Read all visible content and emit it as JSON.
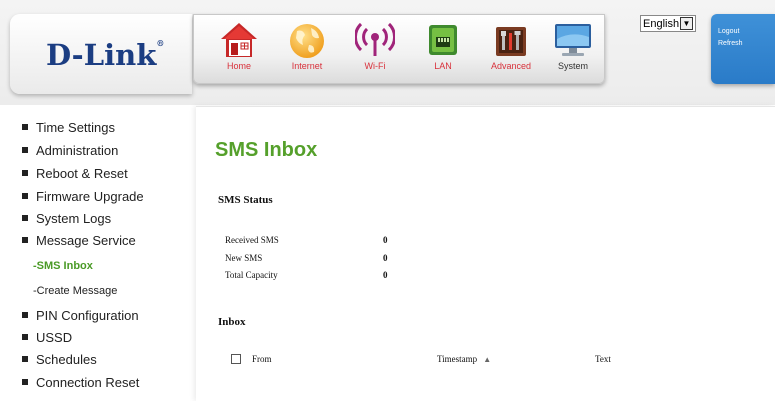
{
  "brand": {
    "logo_text": "D-Link",
    "logo_mark": "®"
  },
  "nav": {
    "items": [
      {
        "label": "Home",
        "icon": "home-icon"
      },
      {
        "label": "Internet",
        "icon": "globe-icon"
      },
      {
        "label": "Wi-Fi",
        "icon": "wifi-icon"
      },
      {
        "label": "LAN",
        "icon": "lan-icon"
      },
      {
        "label": "Advanced",
        "icon": "toolbox-icon"
      },
      {
        "label": "System",
        "icon": "monitor-icon"
      }
    ],
    "active": "System"
  },
  "language": {
    "selected": "English"
  },
  "account": {
    "logout": "Logout",
    "refresh": "Refresh"
  },
  "sidebar": {
    "items": [
      {
        "label": "Time Settings"
      },
      {
        "label": "Administration"
      },
      {
        "label": "Reboot & Reset"
      },
      {
        "label": "Firmware Upgrade"
      },
      {
        "label": "System Logs"
      },
      {
        "label": "Message Service"
      },
      {
        "label": "-SMS Inbox"
      },
      {
        "label": "-Create Message"
      },
      {
        "label": "PIN Configuration"
      },
      {
        "label": "USSD"
      },
      {
        "label": "Schedules"
      },
      {
        "label": "Connection Reset"
      }
    ]
  },
  "main": {
    "title": "SMS Inbox",
    "status_heading": "SMS Status",
    "status": [
      {
        "label": "Received SMS",
        "value": "0"
      },
      {
        "label": "New SMS",
        "value": "0"
      },
      {
        "label": "Total Capacity",
        "value": "0"
      }
    ],
    "inbox_heading": "Inbox",
    "table": {
      "columns": [
        "From",
        "Timestamp",
        "Text"
      ]
    }
  },
  "colors": {
    "accent_green": "#55a02b",
    "nav_label_red": "#d8313b",
    "logo_blue": "#1b3d82",
    "account_blue": "#2a7bc8"
  }
}
